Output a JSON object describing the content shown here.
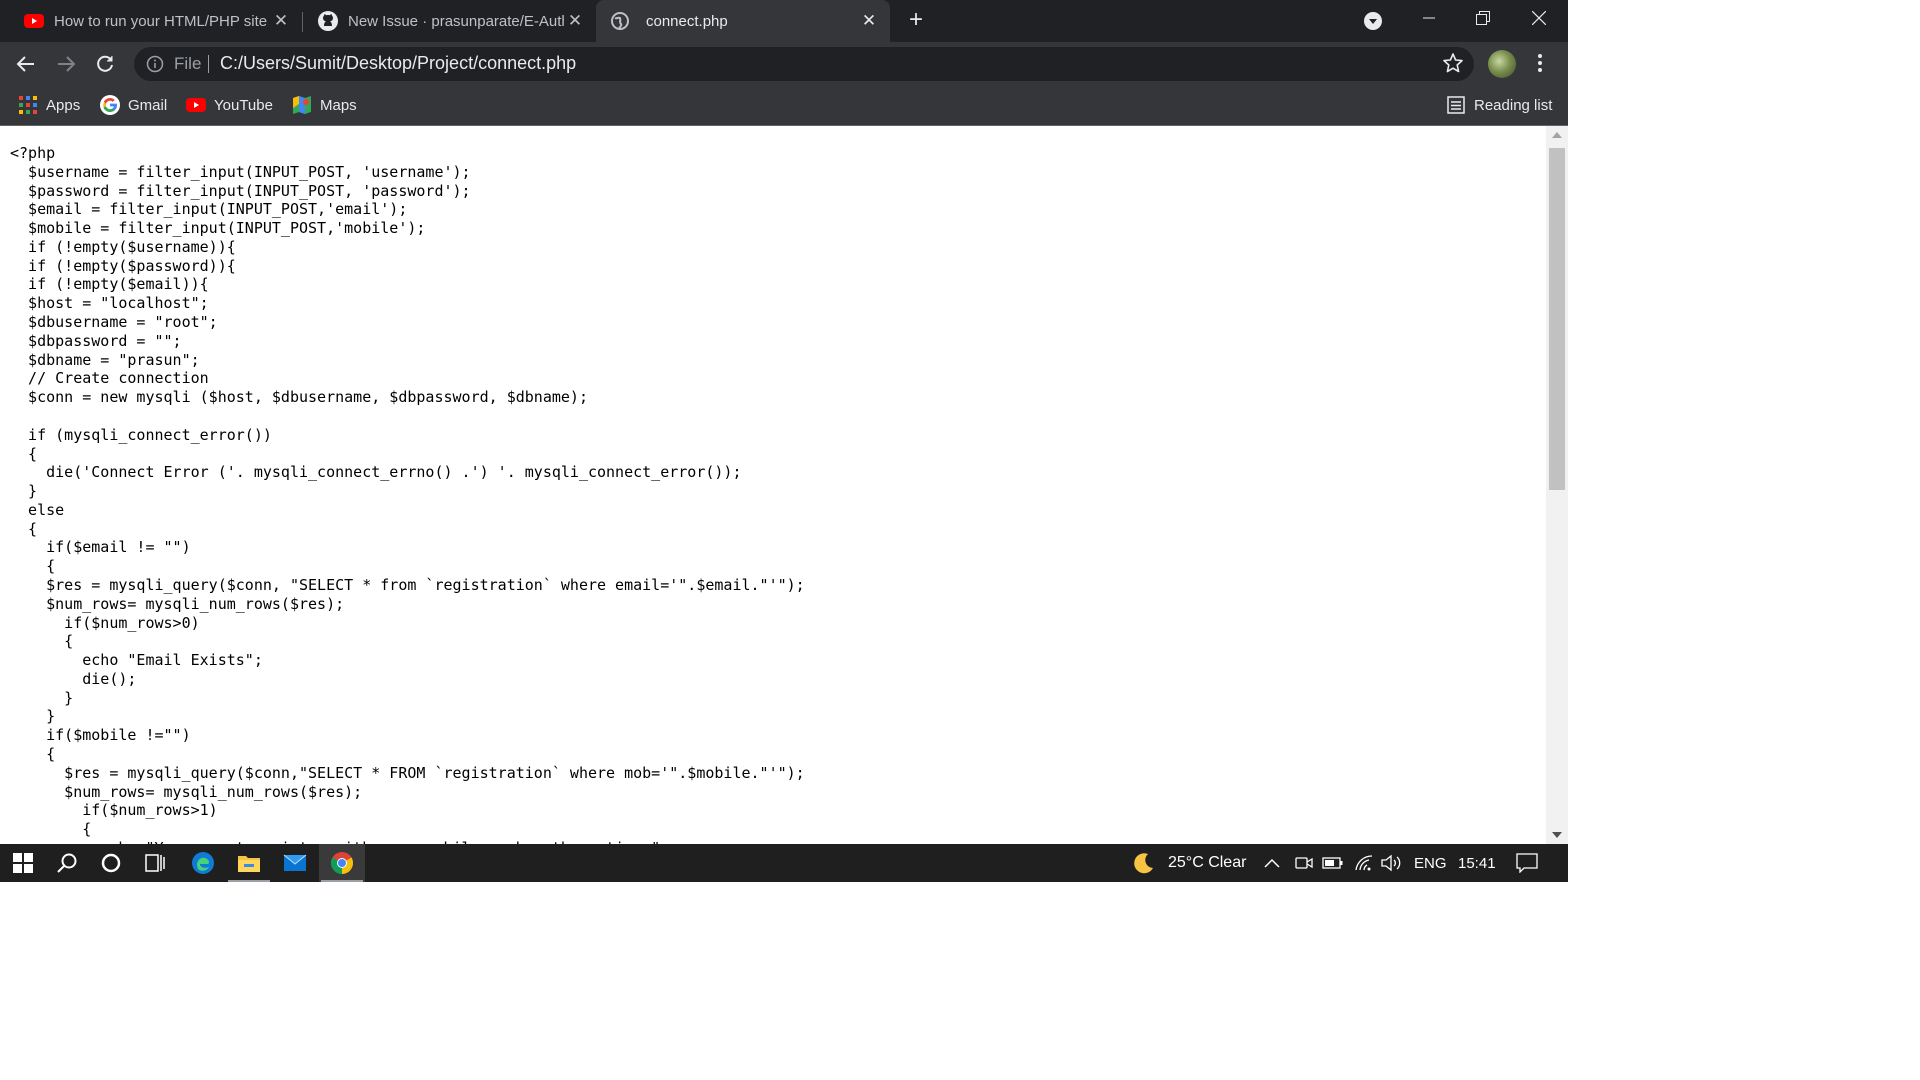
{
  "browser": {
    "tabs": [
      {
        "title": "How to run your HTML/PHP site",
        "icon": "youtube-icon"
      },
      {
        "title": "New Issue · prasunparate/E-Auth",
        "icon": "github-icon"
      },
      {
        "title": "connect.php",
        "icon": "globe-icon",
        "active": true
      }
    ],
    "omnibox": {
      "scheme_label": "File",
      "url": "C:/Users/Sumit/Desktop/Project/connect.php"
    },
    "bookmarks": [
      {
        "label": "Apps",
        "icon": "apps-grid-icon"
      },
      {
        "label": "Gmail",
        "icon": "google-icon"
      },
      {
        "label": "YouTube",
        "icon": "youtube-icon"
      },
      {
        "label": "Maps",
        "icon": "maps-icon"
      }
    ],
    "reading_list_label": "Reading list"
  },
  "page": {
    "code_lines": [
      "<?php",
      "  $username = filter_input(INPUT_POST, 'username');",
      "  $password = filter_input(INPUT_POST, 'password');",
      "  $email = filter_input(INPUT_POST,'email');",
      "  $mobile = filter_input(INPUT_POST,'mobile');",
      "  if (!empty($username)){",
      "  if (!empty($password)){",
      "  if (!empty($email)){",
      "  $host = \"localhost\";",
      "  $dbusername = \"root\";",
      "  $dbpassword = \"\";",
      "  $dbname = \"prasun\";",
      "  // Create connection",
      "  $conn = new mysqli ($host, $dbusername, $dbpassword, $dbname);",
      "",
      "  if (mysqli_connect_error())",
      "  {",
      "    die('Connect Error ('. mysqli_connect_errno() .') '. mysqli_connect_error());",
      "  }",
      "  else",
      "  {",
      "    if($email != \"\")",
      "    {",
      "    $res = mysqli_query($conn, \"SELECT * from `registration` where email='\".$email.\"'\");",
      "    $num_rows= mysqli_num_rows($res);",
      "      if($num_rows>0)",
      "      {",
      "        echo \"Email Exists\";",
      "        die();",
      "      }",
      "    }",
      "    if($mobile !=\"\")",
      "    {",
      "      $res = mysqli_query($conn,\"SELECT * FROM `registration` where mob='\".$mobile.\"'\");",
      "      $num_rows= mysqli_num_rows($res);",
      "        if($num_rows>1)",
      "        {",
      "          echo \"You cannot register with same mobile number three times\";"
    ]
  },
  "taskbar": {
    "weather": "25°C Clear",
    "language": "ENG",
    "time": "15:41",
    "pinned": [
      "windows-start-icon",
      "search-icon",
      "cortana-icon",
      "task-view-icon",
      "edge-icon",
      "file-explorer-icon",
      "mail-icon",
      "chrome-icon"
    ]
  }
}
